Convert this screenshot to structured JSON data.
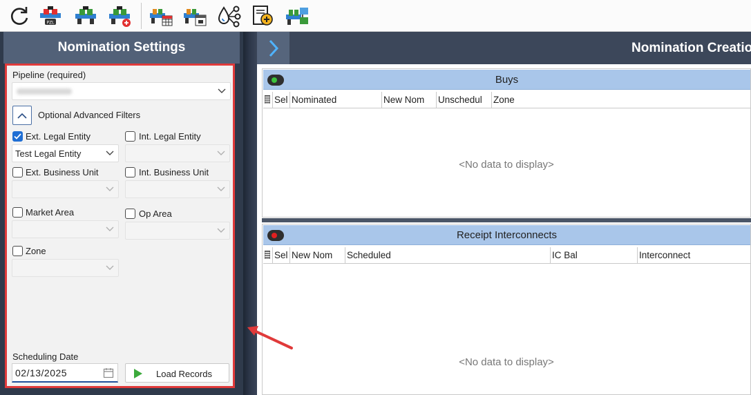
{
  "toolbar": {
    "icons": [
      "refresh-icon",
      "pipeline-pzl-icon",
      "pipeline-check-icon",
      "pipeline-add-icon",
      "pipeline-grid-icon",
      "pipeline-calendar-icon",
      "drops-network-icon",
      "document-add-icon",
      "pipeline-transfer-icon"
    ]
  },
  "left": {
    "title": "Nomination Settings",
    "pipeline_label": "Pipeline (required)",
    "pipeline_value": "",
    "advanced_filters_label": "Optional Advanced Filters",
    "ext_legal_entity": {
      "label": "Ext. Legal Entity",
      "checked": true,
      "value": "Test Legal Entity"
    },
    "int_legal_entity": {
      "label": "Int. Legal Entity",
      "checked": false,
      "value": ""
    },
    "ext_business_unit": {
      "label": "Ext. Business Unit",
      "checked": false,
      "value": ""
    },
    "int_business_unit": {
      "label": "Int. Business Unit",
      "checked": false,
      "value": ""
    },
    "market_area": {
      "label": "Market Area",
      "checked": false,
      "value": ""
    },
    "op_area": {
      "label": "Op Area",
      "checked": false,
      "value": ""
    },
    "zone": {
      "label": "Zone",
      "checked": false,
      "value": ""
    },
    "scheduling_date_label": "Scheduling Date",
    "scheduling_date_value": "02/13/2025",
    "load_button_label": "Load Records"
  },
  "right": {
    "title": "Nomination Creatio",
    "buys": {
      "title": "Buys",
      "columns": [
        "Sel",
        "Nominated",
        "New Nom",
        "Unschedul",
        "Zone"
      ],
      "empty_text": "<No data to display>"
    },
    "receipt": {
      "title": "Receipt Interconnects",
      "columns": [
        "Sel",
        "New Nom",
        "Scheduled",
        "IC Bal",
        "Interconnect"
      ],
      "empty_text": "<No data to display>"
    }
  },
  "colors": {
    "highlight": "#e03a3a",
    "panel_header": "#526178",
    "grid_title": "#a9c6ea",
    "buys_toggle_dot": "#3cc23c",
    "receipt_toggle_dot": "#e02020",
    "checkbox_checked": "#1f6ed4"
  }
}
